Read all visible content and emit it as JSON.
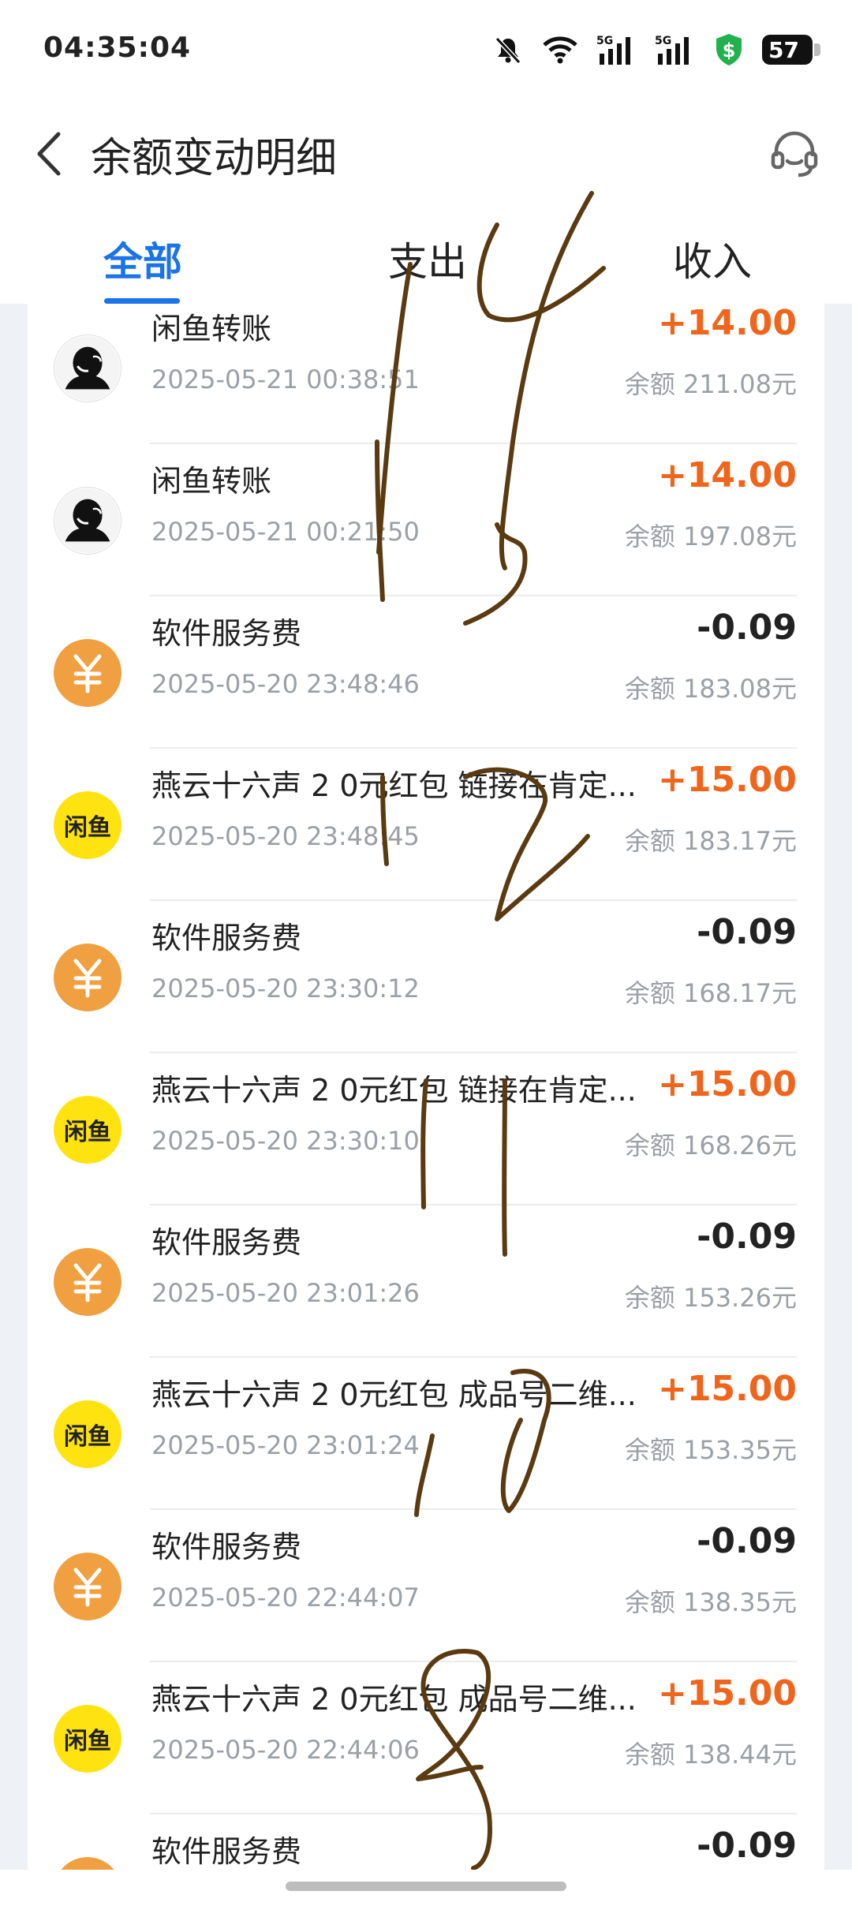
{
  "status_bar": {
    "time": "04:35:04",
    "battery": "57",
    "icons": [
      "mute-icon",
      "wifi-icon",
      "signal-5g-icon",
      "signal-5g-icon",
      "shield-icon"
    ]
  },
  "header": {
    "title": "余额变动明细",
    "back_icon": "chevron-left-icon",
    "service_icon": "headset-icon"
  },
  "tabs": [
    {
      "label": "全部",
      "active": true
    },
    {
      "label": "支出",
      "active": false
    },
    {
      "label": "收入",
      "active": false
    }
  ],
  "colors": {
    "accent": "#1a73e8",
    "positive": "#f0651c",
    "fee_icon": "#f0a040",
    "xianyu_icon": "#ffe311",
    "handwriting": "#5a3a10"
  },
  "transactions": [
    {
      "icon": "user-avatar",
      "name": "闲鱼转账",
      "date": "2025-05-21 00:38:51",
      "amount": "+14.00",
      "balance": "余额 211.08元",
      "positive": true
    },
    {
      "icon": "user-avatar",
      "name": "闲鱼转账",
      "date": "2025-05-21 00:21:50",
      "amount": "+14.00",
      "balance": "余额 197.08元",
      "positive": true
    },
    {
      "icon": "yen-icon",
      "name": "软件服务费",
      "date": "2025-05-20 23:48:46",
      "amount": "-0.09",
      "balance": "余额 183.08元",
      "positive": false
    },
    {
      "icon": "xianyu-icon",
      "name": "燕云十六声 2 0元红包 链接在肯定...",
      "date": "2025-05-20 23:48:45",
      "amount": "+15.00",
      "balance": "余额 183.17元",
      "positive": true
    },
    {
      "icon": "yen-icon",
      "name": "软件服务费",
      "date": "2025-05-20 23:30:12",
      "amount": "-0.09",
      "balance": "余额 168.17元",
      "positive": false
    },
    {
      "icon": "xianyu-icon",
      "name": "燕云十六声 2 0元红包 链接在肯定...",
      "date": "2025-05-20 23:30:10",
      "amount": "+15.00",
      "balance": "余额 168.26元",
      "positive": true
    },
    {
      "icon": "yen-icon",
      "name": "软件服务费",
      "date": "2025-05-20 23:01:26",
      "amount": "-0.09",
      "balance": "余额 153.26元",
      "positive": false
    },
    {
      "icon": "xianyu-icon",
      "name": "燕云十六声 2 0元红包 成品号二维...",
      "date": "2025-05-20 23:01:24",
      "amount": "+15.00",
      "balance": "余额 153.35元",
      "positive": true
    },
    {
      "icon": "yen-icon",
      "name": "软件服务费",
      "date": "2025-05-20 22:44:07",
      "amount": "-0.09",
      "balance": "余额 138.35元",
      "positive": false
    },
    {
      "icon": "xianyu-icon",
      "name": "燕云十六声 2 0元红包 成品号二维...",
      "date": "2025-05-20 22:44:06",
      "amount": "+15.00",
      "balance": "余额 138.44元",
      "positive": true
    },
    {
      "icon": "yen-icon",
      "name": "软件服务费",
      "date": "",
      "amount": "-0.09",
      "balance": "",
      "positive": false
    }
  ],
  "xianyu_logo_text": "闲鱼",
  "yen_glyph": "¥",
  "handwritten_annotations": "handwritten numbers 14, 15, 12, 11, 10, 8 drawn over the list"
}
